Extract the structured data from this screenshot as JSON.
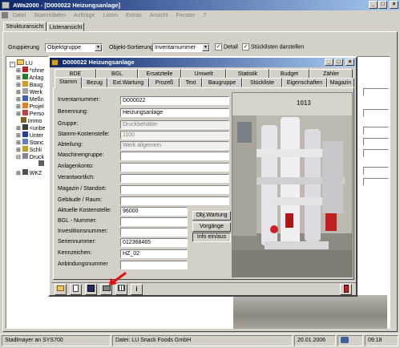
{
  "main_window": {
    "title": "AWa2000 - [D000022 Heizungsanlage]",
    "menu": [
      "Datei",
      "Stammdaten",
      "Aufträge",
      "Listen",
      "Extras",
      "Ansicht",
      "Fenster",
      "?"
    ],
    "view_tabs": [
      "Strukturansicht",
      "Listenansicht"
    ],
    "gruppierung_label": "Gruppierung",
    "gruppierung_value": "Objektgruppe",
    "sortierung_label": "Objekt-Sortierung",
    "sortierung_value": "Inventarnummer",
    "detail_label": "Detail",
    "stueckliste_label": "Stücklisten darstellen"
  },
  "tree": {
    "root": "LU",
    "items": [
      "*ohne",
      "Anlag",
      "Baug",
      "Werk",
      "Meßn",
      "Projel",
      "Perso",
      "Immo",
      "<unbe",
      "Unter",
      "Stanc",
      "Schli",
      "Druck",
      "",
      "WKZ"
    ]
  },
  "dialog": {
    "title": "D000022 Heizungsanlage",
    "tabs_row1": [
      "BDE",
      "BGL",
      "Ersatzteile",
      "Umwelt",
      "Statistik",
      "Budget",
      "Zähler"
    ],
    "tabs_row2": [
      "Stamm",
      "Bezug",
      "Ext.Wartung",
      "Prozeß",
      "Text",
      "Baugruppe",
      "Stückliste",
      "Eigenschaften",
      "Magazin"
    ],
    "fields": [
      {
        "label": "Inventarnummer:",
        "value": "D000022"
      },
      {
        "label": "Benennung:",
        "value": "Heizungsanlage"
      },
      {
        "label": "Gruppe:",
        "value": "Druckbehälter"
      },
      {
        "label": "Stamm-Kostenstelle:",
        "value": "1100"
      },
      {
        "label": "Abteilung:",
        "value": "Werk allgemein"
      },
      {
        "label": "Maschinengruppe:",
        "value": ""
      },
      {
        "label": "Anlagenkonto:",
        "value": ""
      },
      {
        "label": "Verantwortlich:",
        "value": ""
      },
      {
        "label": "Magazin / Standort:",
        "value": ""
      },
      {
        "label": "Gebäude / Raum:",
        "value": ""
      },
      {
        "label": "Aktuelle Kostenstelle:",
        "value": "96000"
      },
      {
        "label": "BGL - Nummer:",
        "value": ""
      },
      {
        "label": "Investitionsnummer:",
        "value": ""
      },
      {
        "label": "Seriennummer:",
        "value": "012368465"
      },
      {
        "label": "Kennzeichen:",
        "value": "HZ_02"
      },
      {
        "label": "Anbindungsnummer",
        "value": ""
      }
    ],
    "buttons": [
      "Obj.Wartung",
      "Vorgänge",
      "Info ein/aus"
    ],
    "image_label": "1013"
  },
  "status_bar": {
    "user": "Stadlmayer an SYS700",
    "file": "Datei: LU Snack Foods GmbH",
    "date": "20.01.2006",
    "time": "09:18"
  },
  "colors": {
    "title_start": "#0a246a",
    "title_end": "#a6caf0",
    "face": "#d4d0c8",
    "arrow": "#e01010"
  }
}
